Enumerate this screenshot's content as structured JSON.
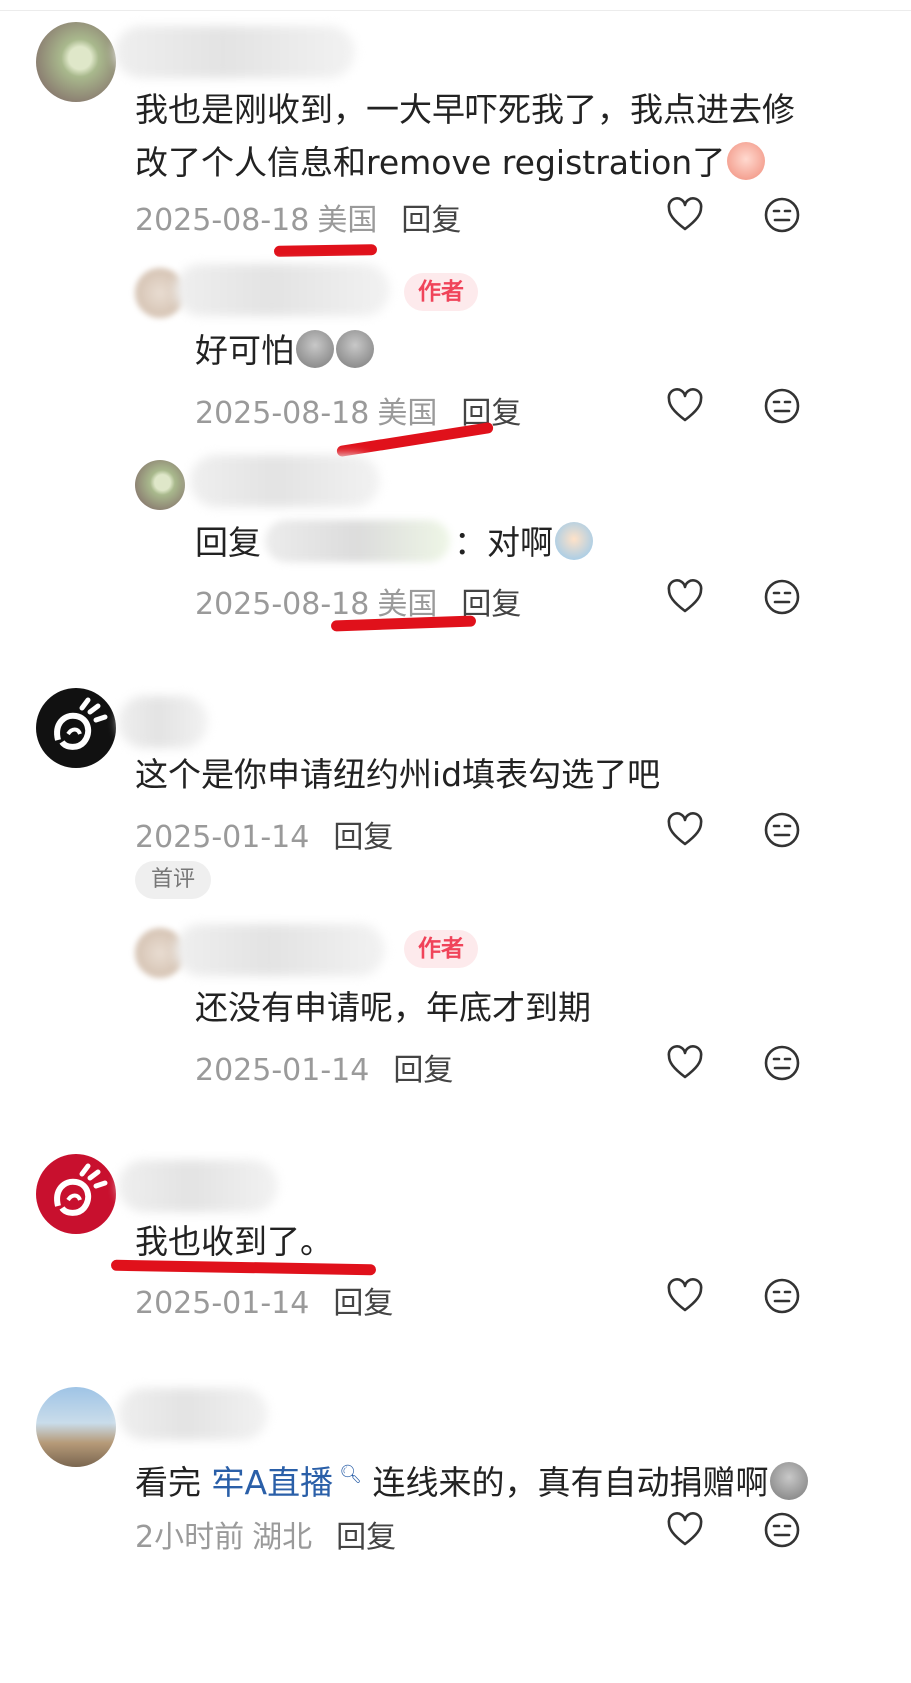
{
  "comments": [
    {
      "text_line1": "我也是刚收到，一大早吓死我了，我点进去修",
      "text_line2": "改了个人信息和remove registration了",
      "date": "2025-08-18",
      "location": "美国",
      "reply": "回复",
      "replies": [
        {
          "tag": "作者",
          "text": "好可怕",
          "date": "2025-08-18",
          "location": "美国",
          "reply": "回复"
        },
        {
          "prefix": "回复",
          "suffix": "：对啊",
          "date": "2025-08-18",
          "location": "美国",
          "reply": "回复"
        }
      ]
    },
    {
      "text": "这个是你申请纽约州id填表勾选了吧",
      "date": "2025-01-14",
      "reply": "回复",
      "badge": "首评",
      "replies": [
        {
          "tag": "作者",
          "text": "还没有申请呢，年底才到期",
          "date": "2025-01-14",
          "reply": "回复"
        }
      ]
    },
    {
      "text": "我也收到了。",
      "date": "2025-01-14",
      "reply": "回复"
    },
    {
      "text_pre": "看完",
      "link": "牢A直播",
      "text_post": "连线来的，真有自动捐赠啊",
      "date": "2小时前",
      "location": "湖北",
      "reply": "回复"
    }
  ],
  "icons": {
    "like": "heart-outline-icon",
    "dislike": "neutral-face-icon",
    "search_superscript": "search-icon"
  },
  "colors": {
    "author_tag": "#f0445a",
    "highlight_line": "#e0111b",
    "link": "#2a5fa8",
    "meta": "#9a9a9a"
  }
}
